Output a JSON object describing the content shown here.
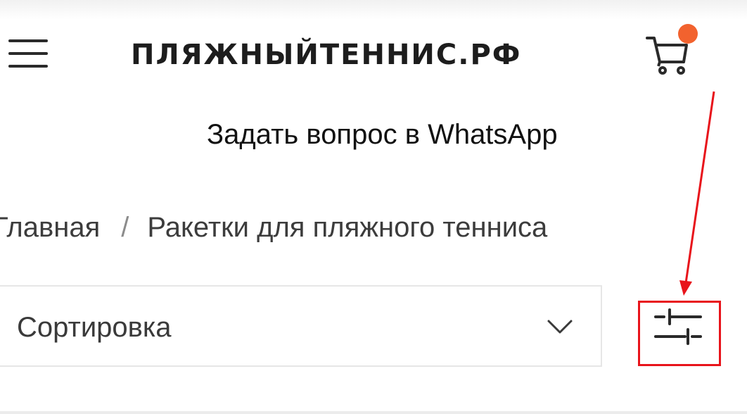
{
  "header": {
    "logo_text": "ПЛЯЖНЫЙТЕННИС.РФ",
    "menu_icon": "hamburger-menu-icon",
    "cart_icon": "shopping-cart-icon",
    "cart_badge_color": "#f2622e"
  },
  "whatsapp": {
    "label": "Задать вопрос в WhatsApp"
  },
  "breadcrumb": {
    "items": [
      "Главная",
      "Ракетки для пляжного тенниса"
    ],
    "separator": "/"
  },
  "sort": {
    "label": "Сортировка",
    "dropdown_icon": "chevron-down-icon"
  },
  "filter": {
    "icon": "filter-sliders-icon"
  },
  "annotation": {
    "color": "#e8141b"
  }
}
